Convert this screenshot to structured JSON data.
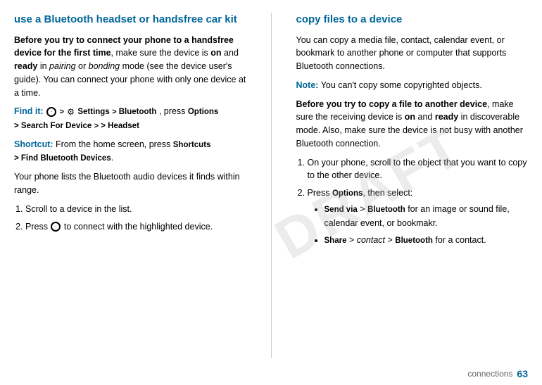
{
  "left": {
    "title": "use a Bluetooth headset or handsfree car kit",
    "para1_bold": "Before you try to connect your phone to a handsfree device for the first time",
    "para1_rest": ", make sure the device is ",
    "para1_on": "on",
    "para1_and": " and ",
    "para1_ready": "ready",
    "para1_rest2": " in ",
    "para1_pairing": "pairing",
    "para1_or": " or ",
    "para1_bonding": "bonding",
    "para1_rest3": " mode (see the device user's guide). You can connect your phone with only one device at a time.",
    "findit_label": "Find it:",
    "findit_path": " > ",
    "findit_settings": "Settings",
    "findit_bluetooth": "Bluetooth",
    "findit_options": "Options",
    "findit_search": "> Search For Device",
    "findit_headset": "> Headset",
    "shortcut_label": "Shortcut:",
    "shortcut_text": " From the home screen, press ",
    "shortcut_shortcuts": "Shortcuts",
    "shortcut_find": "> Find Bluetooth Devices",
    "para2": "Your phone lists the Bluetooth audio devices it finds within range.",
    "step1": "Scroll to a device in the list.",
    "step2_pre": "Press ",
    "step2_dot": "·",
    "step2_post": " to connect with the highlighted device."
  },
  "right": {
    "title": "copy files to a device",
    "para1": "You can copy a media file, contact, calendar event, or bookmark to another phone or computer that supports Bluetooth connections.",
    "note_label": "Note:",
    "note_text": " You can't copy some copyrighted objects.",
    "para2_bold": "Before you try to copy a file to another device",
    "para2_rest": ", make sure the receiving device is ",
    "para2_on": "on",
    "para2_and": " and ",
    "para2_ready": "ready",
    "para2_rest2": " in discoverable mode. Also, make sure the device is not busy with another Bluetooth connection.",
    "step1": "On your phone, scroll to the object that you want to copy to the other device.",
    "step2_pre": "Press ",
    "step2_options": "Options",
    "step2_post": ", then select:",
    "bullet1_bold": "Send via",
    "bullet1_arrow": " > ",
    "bullet1_bluetooth": "Bluetooth",
    "bullet1_rest": " for an image or sound file, calendar event, or bookmakr.",
    "bullet2_bold": "Share",
    "bullet2_arrow": " > ",
    "bullet2_contact": "contact",
    "bullet2_arrow2": " > ",
    "bullet2_bluetooth": "Bluetooth",
    "bullet2_rest": " for a contact."
  },
  "footer": {
    "text": "connections",
    "page": "63"
  },
  "watermark": "DRAFT"
}
